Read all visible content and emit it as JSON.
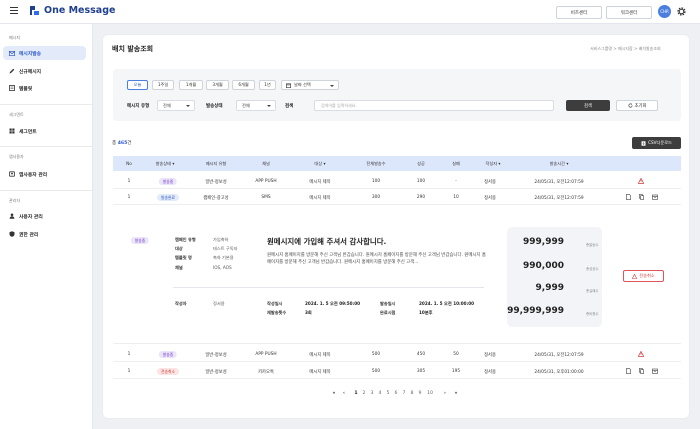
{
  "app": {
    "name": "One Message"
  },
  "topbar": {
    "biz_center": "비즈센터",
    "work_center": "워크센터",
    "avatar_text": "CHR"
  },
  "sidebar": {
    "sections": [
      {
        "title": "메시지",
        "items": [
          "메시지발송",
          "신규메시지",
          "템플릿"
        ]
      },
      {
        "title": "세그먼트",
        "items": [
          "세그먼트"
        ]
      },
      {
        "title": "앱사용자",
        "items": [
          "앱사용자 관리"
        ]
      },
      {
        "title": "관리자",
        "items": [
          "사용자 관리",
          "권한 관리"
        ]
      }
    ]
  },
  "page": {
    "title": "배치 발송조회",
    "breadcrumb": [
      "서비스그룹명",
      "메시지함",
      "배치발송조회"
    ]
  },
  "filter": {
    "periods": [
      "오늘",
      "1주일",
      "1개월",
      "3개월",
      "6개월",
      "1년"
    ],
    "date_select": "날짜 선택",
    "message_type_label": "메시지 유형",
    "message_type_value": "전체",
    "send_status_label": "발송상태",
    "send_status_value": "전체",
    "search_label": "검색",
    "search_placeholder": "검색어를 입력하세요.",
    "search_button": "검색",
    "reset_button": "초기화"
  },
  "list": {
    "total_prefix": "총 ",
    "total_count": "465",
    "total_suffix": "건",
    "csv_button": "CSV다운로드",
    "columns": [
      "No",
      "발송상태",
      "메시지 유형",
      "채널",
      "대상",
      "전체발송수",
      "성공",
      "실패",
      "작성자",
      "발송시간"
    ],
    "rows": [
      {
        "no": "1",
        "status": "발송중",
        "type": "일반-정보성",
        "channel": "APP PUSH",
        "target": "메시지 제목",
        "total": "100",
        "success": "100",
        "fail": "-",
        "author": "정서용",
        "time": "24/05/31, 오전12:07:59"
      },
      {
        "no": "1",
        "status": "발송완료",
        "type": "캠페인-광고성",
        "channel": "SMS",
        "target": "메시지 제목",
        "total": "300",
        "success": "290",
        "fail": "10",
        "author": "정서용",
        "time": "24/05/31, 오전12:07:59"
      },
      {
        "no": "1",
        "status": "발송중",
        "type": "일반-정보성",
        "channel": "APP PUSH",
        "target": "메시지 제목",
        "total": "500",
        "success": "450",
        "fail": "50",
        "author": "정서용",
        "time": "24/05/31, 오전12:07:59"
      },
      {
        "no": "1",
        "status": "전송취소",
        "type": "일반-정보성",
        "channel": "카카오톡",
        "target": "메시지 제목",
        "total": "500",
        "success": "305",
        "fail": "195",
        "author": "정서용",
        "time": "24/05/31, 오후01:00:00"
      }
    ]
  },
  "detail": {
    "status": "발송중",
    "fields": [
      {
        "k": "캠페인 유형",
        "v": "가입축하"
      },
      {
        "k": "대상",
        "v": "테스트 구독자"
      },
      {
        "k": "템플릿 명",
        "v": "축하 기본용"
      },
      {
        "k": "채널",
        "v": "IOS, AOS"
      }
    ],
    "message_title": "원메시지에 가입해 주셔서 감사합니다.",
    "message_body": "원메시지 홈페이지를 방문해 주신 고객님 반갑습니다. 원메시지 홈페이지를 방문해 주신 고객님 반갑습니다. 원메시지 홈페이지를 방문해 주신 고객님 반갑습니다. 원메시지 홈페이지를 방문해 주신 고객...",
    "author_label": "작성자",
    "author": "정서용",
    "created_label": "작성일시",
    "created": "2024. 1. 5 오전 09:50:00",
    "resend_label": "재발송횟수",
    "resend": "3회",
    "sent_label": "발송일시",
    "sent": "2024. 1. 5 오전 10:00:00",
    "duration_label": "완료시점",
    "duration": "10분후",
    "stats": [
      {
        "value": "999,999",
        "label": "총발송수"
      },
      {
        "value": "990,000",
        "label": "총성공수"
      },
      {
        "value": "9,999",
        "label": "총실패수"
      },
      {
        "value": "99,999,999",
        "label": "총비용수"
      }
    ],
    "cancel_button": "전송취소"
  },
  "pagination": {
    "pages": [
      "1",
      "2",
      "3",
      "4",
      "5",
      "6",
      "7",
      "8",
      "9",
      "10"
    ],
    "current": "1"
  },
  "colors": {
    "accent": "#2a57c8",
    "header_bg": "#dde7fb",
    "dark_button": "#3d3d3d"
  }
}
